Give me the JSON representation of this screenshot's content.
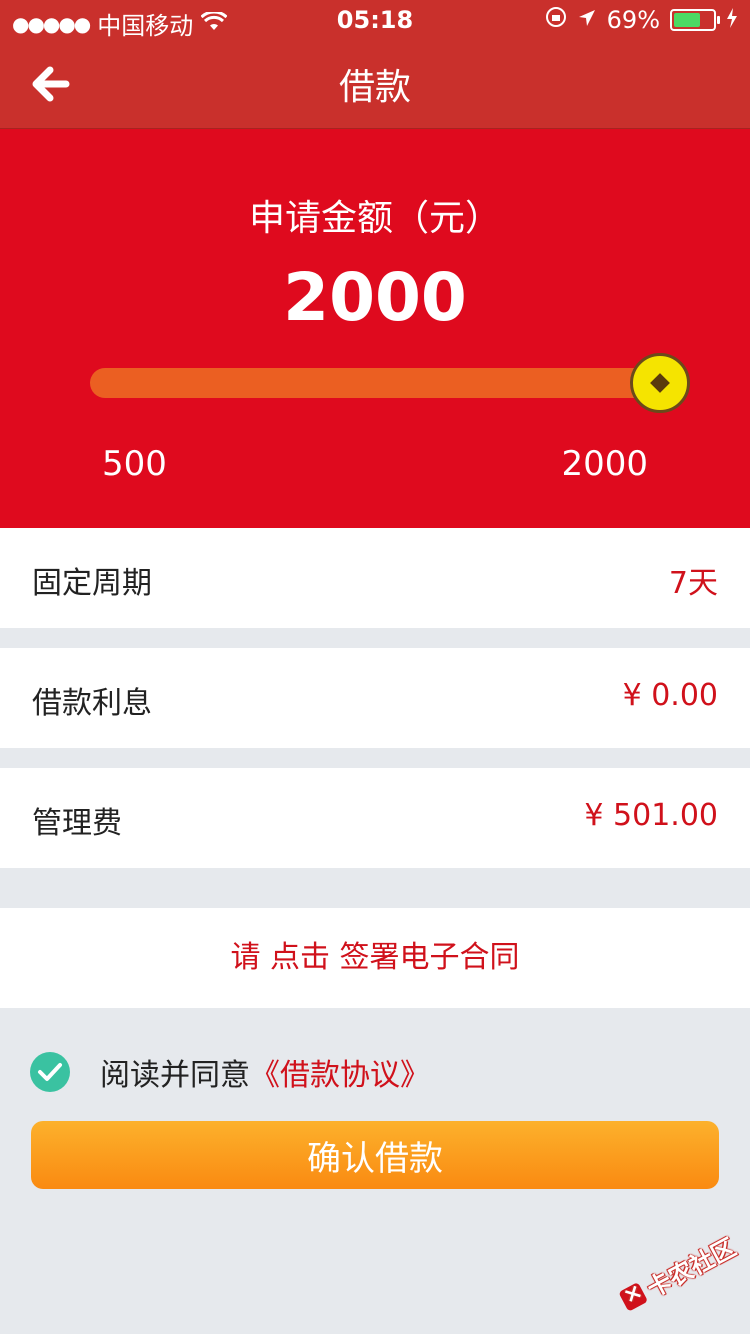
{
  "status_bar": {
    "signal": "●●●●●",
    "carrier": "中国移动",
    "time": "05:18",
    "battery_pct": "69%",
    "battery_level": 0.69,
    "battery_color": "#4cd964"
  },
  "nav": {
    "title": "借款",
    "back_icon": "arrow-left-icon"
  },
  "hero": {
    "label": "申请金额（元）",
    "amount": "2000",
    "min": "500",
    "max": "2000",
    "slider_value": 2000,
    "slider_min": 500,
    "slider_max": 2000,
    "bg_color": "#df0a1e"
  },
  "rows": [
    {
      "label": "固定周期",
      "value": "7天"
    },
    {
      "label": "借款利息",
      "value": "¥ 0.00"
    },
    {
      "label": "管理费",
      "value": "¥ 501.00"
    }
  ],
  "contract": {
    "text": "请 点击 签署电子合同"
  },
  "agreement": {
    "text": "阅读并同意",
    "link": "《借款协议》",
    "checked": true
  },
  "confirm": {
    "label": "确认借款"
  },
  "watermark": {
    "text": "卡农社区"
  },
  "colors": {
    "accent_red": "#d0111b",
    "header_red": "#c9302c",
    "check_teal": "#3ac2a1",
    "button_orange": "#fa8a11"
  }
}
